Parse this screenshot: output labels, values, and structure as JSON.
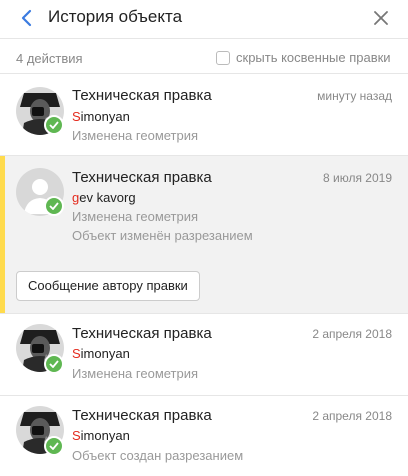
{
  "header": {
    "title": "История объекта",
    "back_icon": "chevron-left-icon",
    "close_icon": "close-icon"
  },
  "toolbar": {
    "count": "4 действия",
    "indirect_label": "скрыть косвенные правки",
    "indirect_checked": false
  },
  "entries": [
    {
      "title": "Техническая правка",
      "date": "минуту назад",
      "author_first": "S",
      "author_rest": "imonyan",
      "changes": [
        "Изменена геометрия"
      ],
      "avatar": "photo",
      "status": "approved"
    },
    {
      "title": "Техническая правка",
      "date": "8 июля 2019",
      "author_first": "g",
      "author_rest": "ev kavorg",
      "changes": [
        "Изменена геометрия",
        "Объект изменён разрезанием"
      ],
      "avatar": "placeholder",
      "status": "approved",
      "selected": true,
      "message_button": "Сообщение автору правки"
    },
    {
      "title": "Техническая правка",
      "date": "2 апреля 2018",
      "author_first": "S",
      "author_rest": "imonyan",
      "changes": [
        "Изменена геометрия"
      ],
      "avatar": "photo",
      "status": "approved"
    },
    {
      "title": "Техническая правка",
      "date": "2 апреля 2018",
      "author_first": "S",
      "author_rest": "imonyan",
      "changes": [
        "Объект создан разрезанием"
      ],
      "avatar": "photo",
      "status": "approved"
    }
  ],
  "colors": {
    "accent": "#ffdb4d",
    "approved": "#5fb752",
    "author_initial": "#e42a1d",
    "back_arrow": "#3b7be0"
  }
}
